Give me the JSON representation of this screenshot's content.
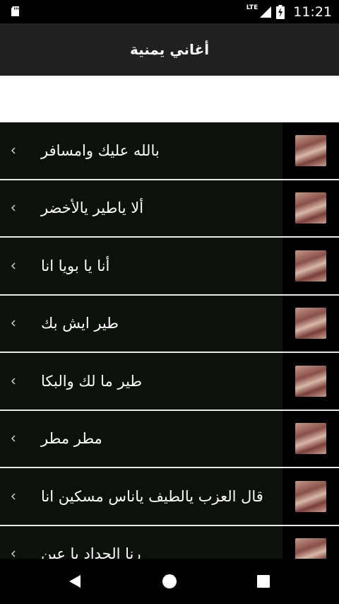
{
  "status_bar": {
    "network": "LTE",
    "time": "11:21",
    "icons": [
      "sd-card-icon",
      "signal-icon",
      "battery-charging-icon"
    ]
  },
  "app_bar": {
    "title": "أغاني يمنية"
  },
  "songs": [
    {
      "title": "بالله عليك وامسافر",
      "icon": "song-thumbnail-icon"
    },
    {
      "title": "ألا ياطير يالأخضر",
      "icon": "song-thumbnail-icon"
    },
    {
      "title": "أنا يا بويا انا",
      "icon": "song-thumbnail-icon"
    },
    {
      "title": "طير ايش بك",
      "icon": "song-thumbnail-icon"
    },
    {
      "title": "طير ما لك والبكا",
      "icon": "song-thumbnail-icon"
    },
    {
      "title": "مطر مطر",
      "icon": "song-thumbnail-icon"
    },
    {
      "title": "قال العزب يالطيف ياناس مسكين انا",
      "icon": "song-thumbnail-icon"
    },
    {
      "title": "رنا الحداد يا عين",
      "icon": "song-thumbnail-icon"
    }
  ],
  "nav_bar": {
    "icons": [
      "back-icon",
      "home-icon",
      "recents-icon"
    ]
  },
  "colors": {
    "app_bar": "#212121",
    "row_background": "#0c110c",
    "divider": "#e8e8e8",
    "banner": "#ffffff"
  }
}
